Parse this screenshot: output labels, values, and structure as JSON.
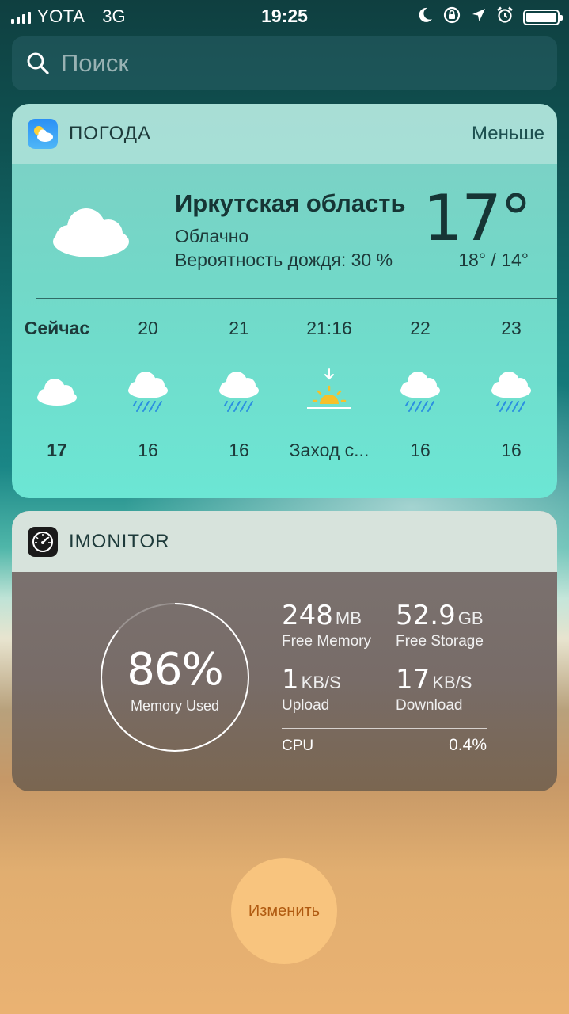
{
  "status_bar": {
    "carrier": "YOTA",
    "network": "3G",
    "time": "19:25",
    "icons": [
      "signal-icon",
      "moon-icon",
      "rotation-lock-icon",
      "location-icon",
      "alarm-icon",
      "battery-icon"
    ]
  },
  "search": {
    "placeholder": "Поиск"
  },
  "weather": {
    "title": "ПОГОДА",
    "less_label": "Меньше",
    "location": "Иркутская область",
    "condition": "Облачно",
    "rain": "Вероятность дождя: 30 %",
    "temperature": "17°",
    "hi_lo": "18° / 14°",
    "hours": [
      {
        "time": "Сейчас",
        "icon": "cloud-icon",
        "temp": "17"
      },
      {
        "time": "20",
        "icon": "rain-cloud-icon",
        "temp": "16"
      },
      {
        "time": "21",
        "icon": "rain-cloud-icon",
        "temp": "16"
      },
      {
        "time": "21:16",
        "icon": "sunset-icon",
        "temp": "Заход с..."
      },
      {
        "time": "22",
        "icon": "rain-cloud-icon",
        "temp": "16"
      },
      {
        "time": "23",
        "icon": "rain-cloud-icon",
        "temp": "16"
      }
    ]
  },
  "imonitor": {
    "title": "IMONITOR",
    "memory_used_pct": "86%",
    "memory_used_fraction": 0.86,
    "memory_used_label": "Memory Used",
    "free_memory": {
      "value": "248",
      "unit": "MB",
      "label": "Free Memory"
    },
    "free_storage": {
      "value": "52.9",
      "unit": "GB",
      "label": "Free Storage"
    },
    "upload": {
      "value": "1",
      "unit": "KB/S",
      "label": "Upload"
    },
    "download": {
      "value": "17",
      "unit": "KB/S",
      "label": "Download"
    },
    "cpu_label": "CPU",
    "cpu_value": "0.4%"
  },
  "edit_button": {
    "label": "Изменить"
  },
  "colors": {
    "weather_text": "#1d3a3a",
    "edit_button": "#f8c47e",
    "edit_text": "#b05a10"
  }
}
